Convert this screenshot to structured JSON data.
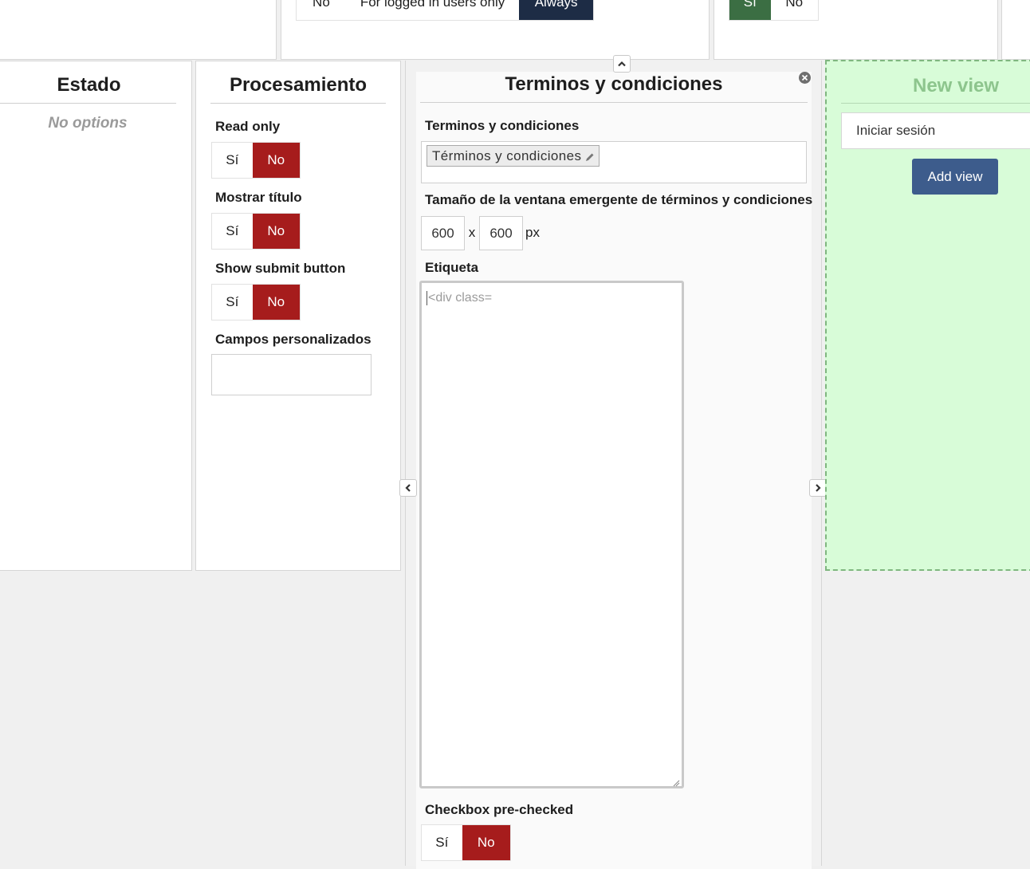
{
  "top": {
    "visibility": {
      "options": [
        "No",
        "For logged in users only",
        "Always"
      ],
      "selected": "Always"
    },
    "toggle": {
      "options": [
        "Sí",
        "No"
      ],
      "selected": "Sí"
    }
  },
  "estado": {
    "title": "Estado",
    "empty": "No options"
  },
  "procesamiento": {
    "title": "Procesamiento",
    "read_only": {
      "label": "Read only",
      "yes": "Sí",
      "no": "No",
      "selected": "No"
    },
    "mostrar_titulo": {
      "label": "Mostrar título",
      "yes": "Sí",
      "no": "No",
      "selected": "No"
    },
    "show_submit": {
      "label": "Show submit button",
      "yes": "Sí",
      "no": "No",
      "selected": "No"
    },
    "campos": {
      "label": "Campos personalizados",
      "value": ""
    }
  },
  "terminos": {
    "title": "Terminos y condiciones",
    "field_label": "Terminos y condiciones",
    "tag": "Términos y condiciones",
    "size_label": "Tamaño de la ventana emergente de términos y condiciones",
    "width": "600",
    "height": "600",
    "x": "x",
    "unit": "px",
    "etiqueta_label": "Etiqueta",
    "etiqueta_value": "<div class=",
    "prechecked": {
      "label": "Checkbox pre-checked",
      "yes": "Sí",
      "no": "No",
      "selected": "No"
    }
  },
  "new_view": {
    "title": "New view",
    "select_value": "Iniciar sesión",
    "button": "Add view"
  },
  "colors": {
    "accent_red": "#a61c1c",
    "navy": "#1d2c45",
    "green": "#3b6e43",
    "button_blue": "#3d5c8c",
    "new_view_bg": "#d8fcd8",
    "new_view_title": "#8dc58d"
  }
}
